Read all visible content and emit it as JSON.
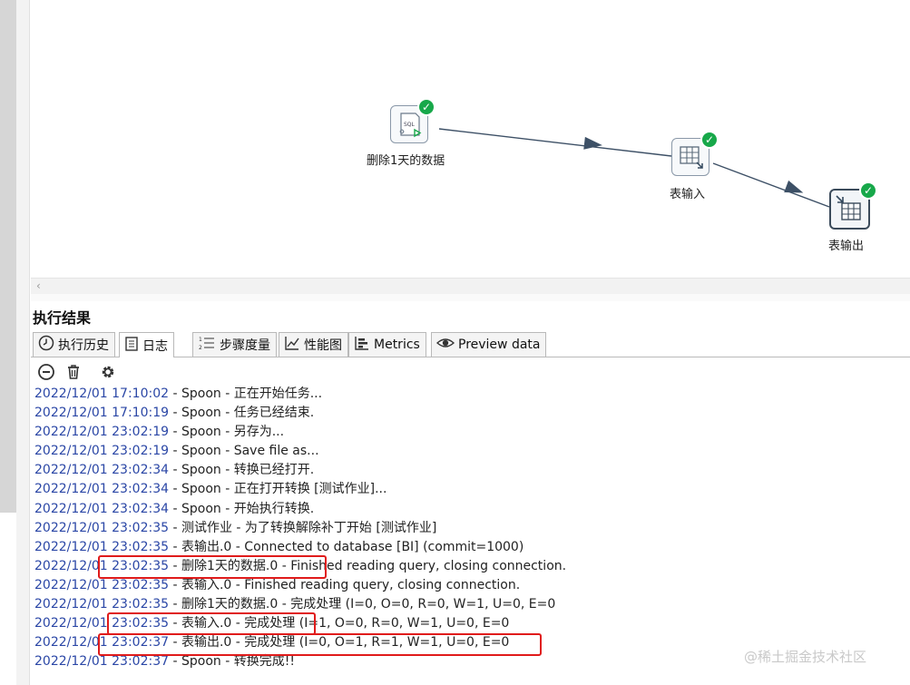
{
  "canvas": {
    "steps": [
      {
        "label": "删除1天的数据",
        "icon": "sql-script-icon"
      },
      {
        "label": "表输入",
        "icon": "table-input-icon"
      },
      {
        "label": "表输出",
        "icon": "table-output-icon"
      }
    ],
    "sql_badge": "SQL"
  },
  "results": {
    "title": "执行结果",
    "tabs": [
      {
        "label": "执行历史",
        "icon": "clock-icon"
      },
      {
        "label": "日志",
        "icon": "log-icon"
      },
      {
        "label": "步骤度量",
        "icon": "list-numbered-icon"
      },
      {
        "label": "性能图",
        "icon": "line-chart-icon"
      },
      {
        "label": "Metrics",
        "icon": "metrics-icon"
      },
      {
        "label": "Preview data",
        "icon": "eye-icon"
      }
    ],
    "toolbar": [
      "stop-icon",
      "trash-icon",
      "gear-icon"
    ]
  },
  "log": [
    {
      "ts": "2022/12/01 17:10:02",
      "msg": " - Spoon - 正在开始任务..."
    },
    {
      "ts": "2022/12/01 17:10:19",
      "msg": " - Spoon - 任务已经结束."
    },
    {
      "ts": "2022/12/01 23:02:19",
      "msg": " - Spoon - 另存为..."
    },
    {
      "ts": "2022/12/01 23:02:19",
      "msg": " - Spoon - Save file as..."
    },
    {
      "ts": "2022/12/01 23:02:34",
      "msg": " - Spoon - 转换已经打开."
    },
    {
      "ts": "2022/12/01 23:02:34",
      "msg": " - Spoon - 正在打开转换 [测试作业]..."
    },
    {
      "ts": "2022/12/01 23:02:34",
      "msg": " - Spoon - 开始执行转换."
    },
    {
      "ts": "2022/12/01 23:02:35",
      "msg": " - 测试作业 - 为了转换解除补丁开始  [测试作业]"
    },
    {
      "ts": "2022/12/01 23:02:35",
      "msg": " - 表输出.0 - Connected to database [BI] (commit=1000)"
    },
    {
      "ts": "2022/12/01 23:02:35",
      "msg": " - 删除1天的数据.0 - Finished reading query, closing connection."
    },
    {
      "ts": "2022/12/01 23:02:35",
      "msg": " - 表输入.0 - Finished reading query, closing connection."
    },
    {
      "ts": "2022/12/01 23:02:35",
      "msg": " - 删除1天的数据.0 - 完成处理 (I=0, O=0, R=0, W=1, U=0, E=0"
    },
    {
      "ts": "2022/12/01 23:02:35",
      "msg": " - 表输入.0 - 完成处理 (I=1, O=0, R=0, W=1, U=0, E=0"
    },
    {
      "ts": "2022/12/01 23:02:37",
      "msg": " - 表输出.0 - 完成处理 (I=0, O=1, R=1, W=1, U=0, E=0"
    },
    {
      "ts": "2022/12/01 23:02:37",
      "msg": " - Spoon - 转换完成!!"
    }
  ],
  "watermark": "@稀土掘金技术社区",
  "colors": {
    "timestamp": "#2b47a6",
    "highlight": "#e01b1b",
    "ok": "#17a84a"
  }
}
